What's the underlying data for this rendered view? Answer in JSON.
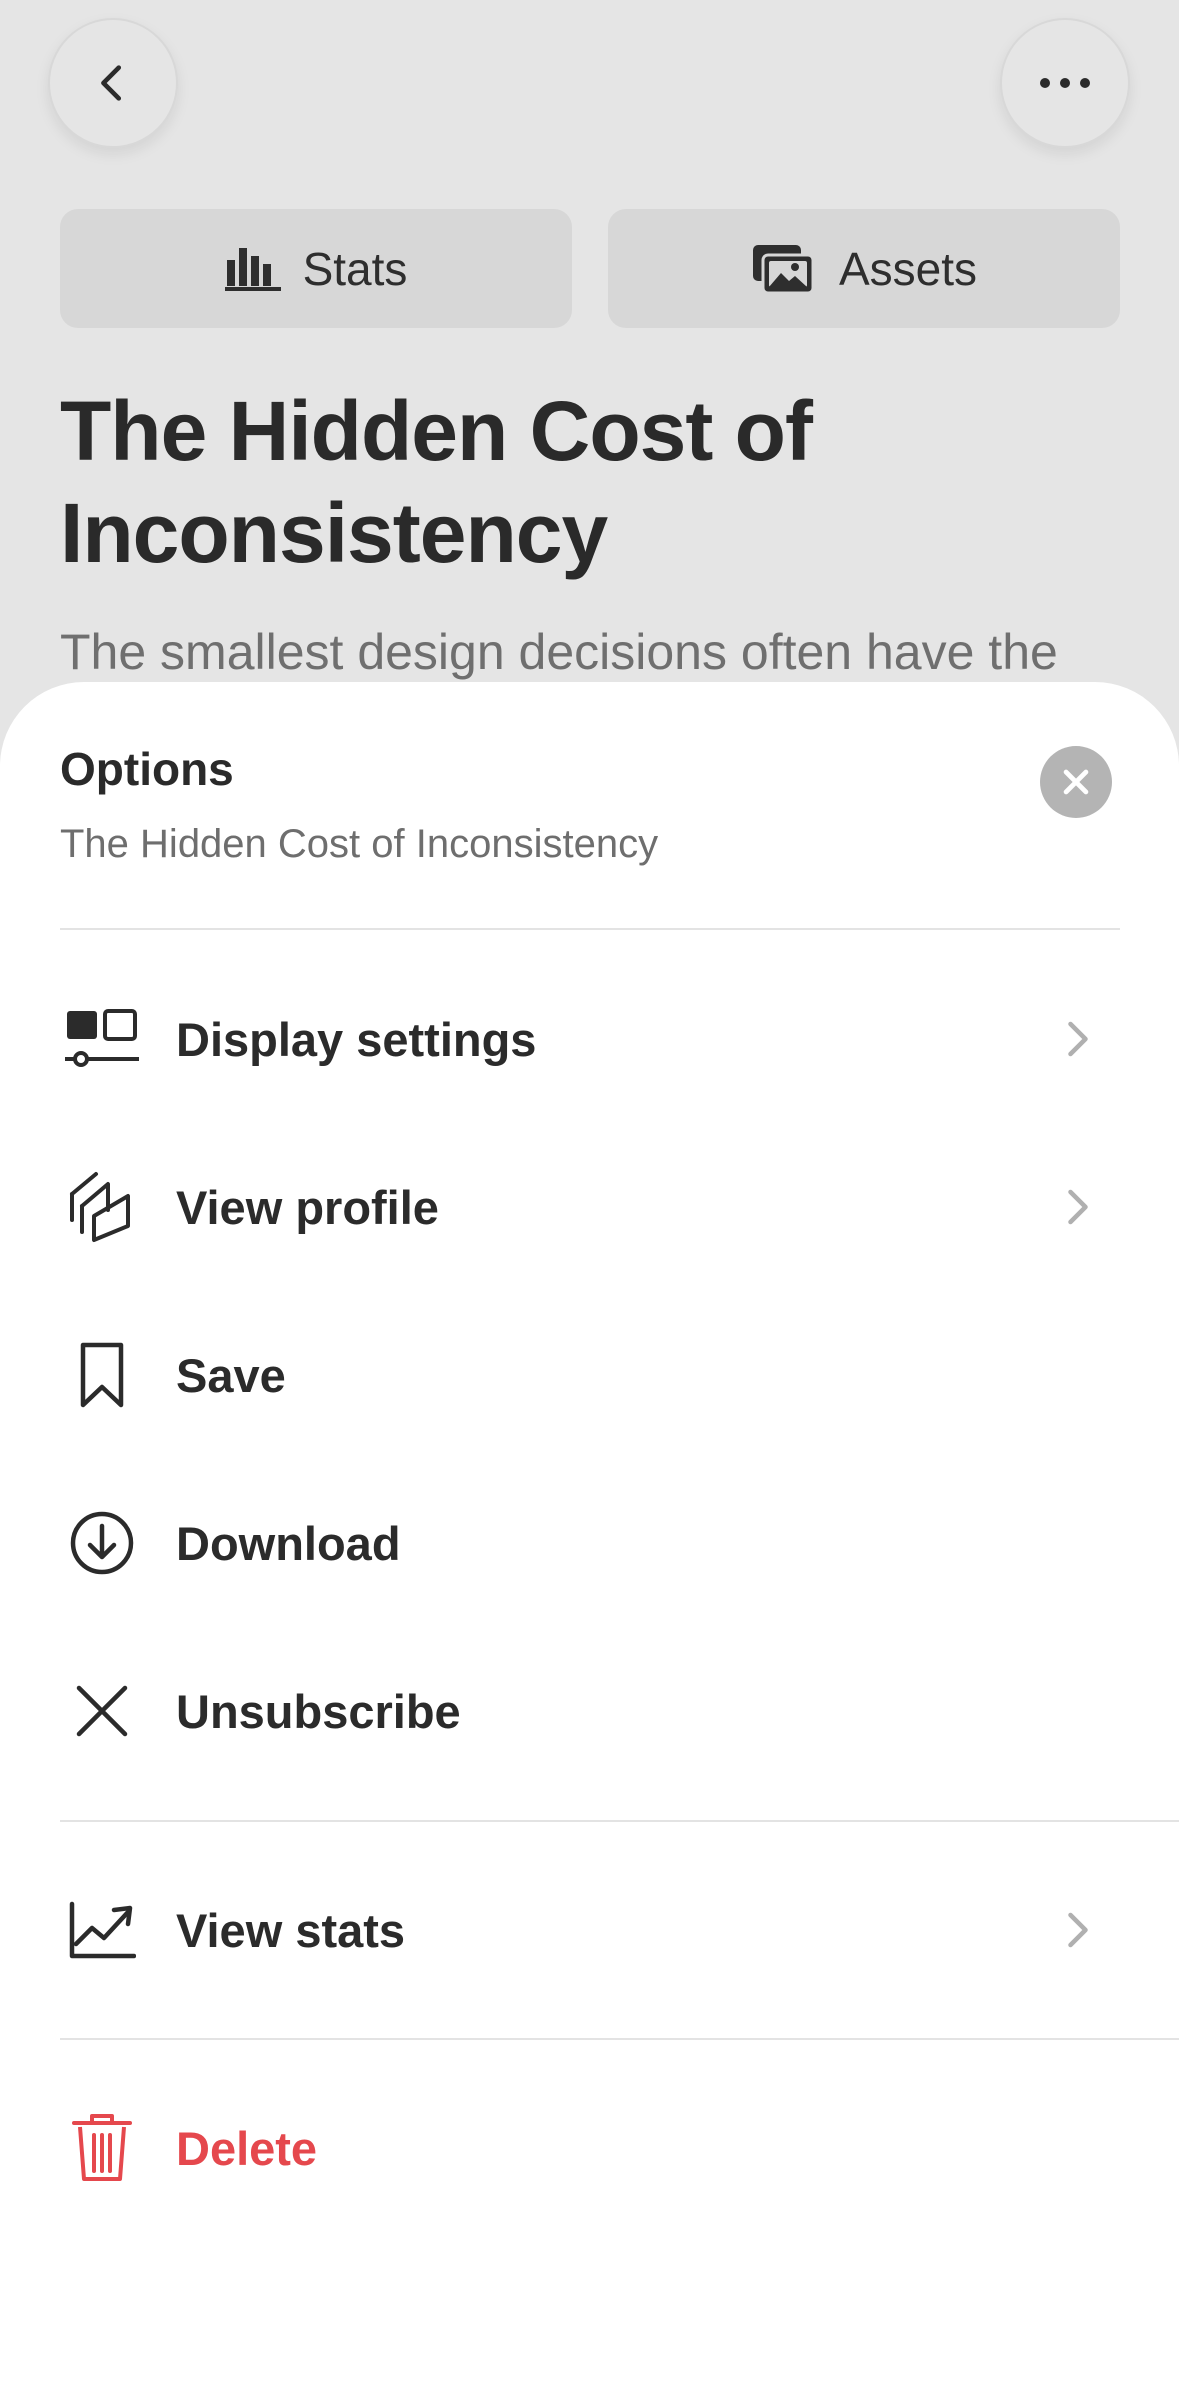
{
  "colors": {
    "background": "#e5e5e5",
    "sheet": "#ffffff",
    "text": "#2b2b2b",
    "muted": "#6e6e6e",
    "chevron": "#b0b0b0",
    "danger": "#e5484d"
  },
  "header": {
    "back_icon": "chevron-left-icon",
    "more_icon": "ellipsis-icon"
  },
  "segments": {
    "stats": {
      "label": "Stats",
      "icon": "bar-chart-icon"
    },
    "assets": {
      "label": "Assets",
      "icon": "images-icon"
    }
  },
  "article": {
    "title": "The Hidden Cost of Inconsistency",
    "lede": "The smallest design decisions often have the"
  },
  "sheet": {
    "title": "Options",
    "subtitle": "The Hidden Cost of Inconsistency",
    "close_icon": "close-icon",
    "items": [
      {
        "label": "Display settings",
        "icon": "display-settings-icon",
        "chevron": true
      },
      {
        "label": "View profile",
        "icon": "stacked-cards-icon",
        "chevron": true
      },
      {
        "label": "Save",
        "icon": "bookmark-icon",
        "chevron": false
      },
      {
        "label": "Download",
        "icon": "download-circle-icon",
        "chevron": false
      },
      {
        "label": "Unsubscribe",
        "icon": "x-icon",
        "chevron": false
      },
      {
        "label": "View stats",
        "icon": "trending-chart-icon",
        "chevron": true
      },
      {
        "label": "Delete",
        "icon": "trash-icon",
        "chevron": false,
        "danger": true
      }
    ]
  }
}
